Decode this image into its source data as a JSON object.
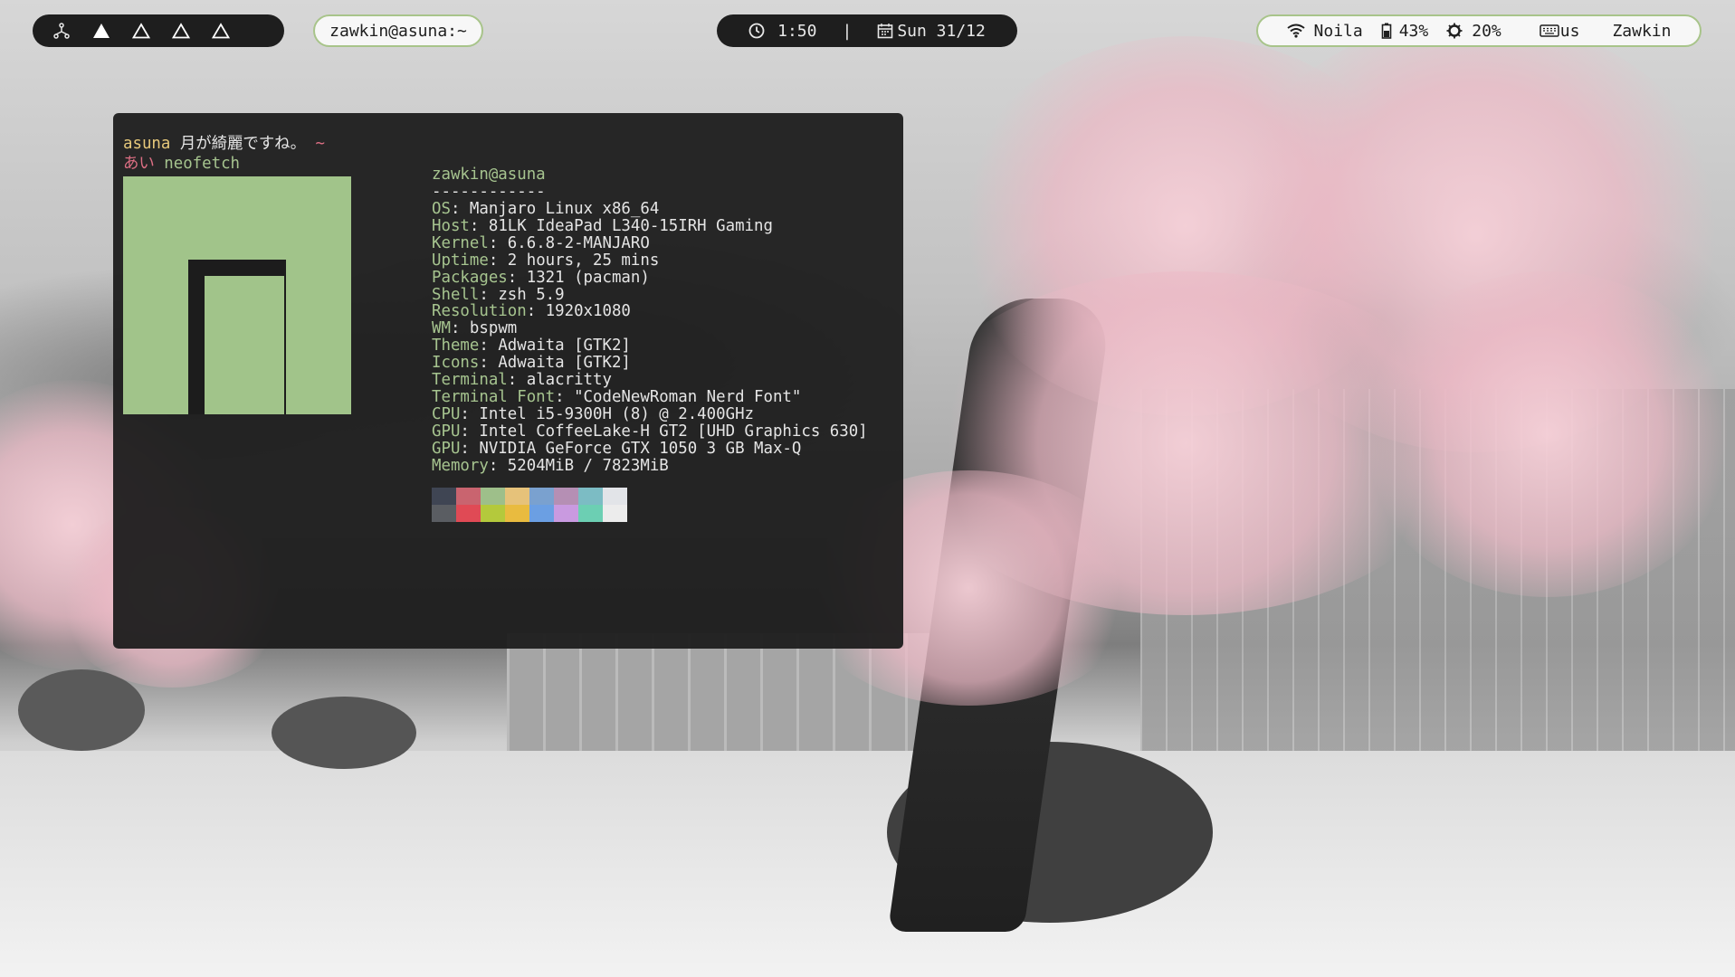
{
  "topbar": {
    "workspaces": [
      {
        "name": "workspace-1",
        "icon": "network-icon"
      },
      {
        "name": "workspace-2",
        "icon": "triangle-filled-icon"
      },
      {
        "name": "workspace-3",
        "icon": "triangle-outline-icon"
      },
      {
        "name": "workspace-4",
        "icon": "triangle-outline-icon"
      },
      {
        "name": "workspace-5",
        "icon": "triangle-outline-icon"
      }
    ],
    "window_title": "zawkin@asuna:~",
    "time": "1:50",
    "separator": "|",
    "date": "Sun 31/12",
    "wifi_name": "Noila",
    "battery": "43%",
    "brightness": "20%",
    "keyboard_layout": "us",
    "username": "Zawkin",
    "accent": "#a8c48a"
  },
  "terminal": {
    "prompt_user": "asuna",
    "prompt_text": " 月が綺麗ですね。",
    "prompt_dir": " ~",
    "prompt2_symbol": "あい",
    "command": " neofetch",
    "header": "zawkin@asuna",
    "divider": "------------",
    "info": [
      {
        "key": "OS",
        "value": " Manjaro Linux x86_64"
      },
      {
        "key": "Host",
        "value": " 81LK IdeaPad L340-15IRH Gaming"
      },
      {
        "key": "Kernel",
        "value": " 6.6.8-2-MANJARO"
      },
      {
        "key": "Uptime",
        "value": " 2 hours, 25 mins"
      },
      {
        "key": "Packages",
        "value": " 1321 (pacman)"
      },
      {
        "key": "Shell",
        "value": " zsh 5.9"
      },
      {
        "key": "Resolution",
        "value": " 1920x1080"
      },
      {
        "key": "WM",
        "value": " bspwm"
      },
      {
        "key": "Theme",
        "value": " Adwaita [GTK2]"
      },
      {
        "key": "Icons",
        "value": " Adwaita [GTK2]"
      },
      {
        "key": "Terminal",
        "value": " alacritty"
      },
      {
        "key": "Terminal Font",
        "value": " \"CodeNewRoman Nerd Font\""
      },
      {
        "key": "CPU",
        "value": " Intel i5-9300H (8) @ 2.400GHz"
      },
      {
        "key": "GPU",
        "value": " Intel CoffeeLake-H GT2 [UHD Graphics 630]"
      },
      {
        "key": "GPU",
        "value": " NVIDIA GeForce GTX 1050 3 GB Max-Q"
      },
      {
        "key": "Memory",
        "value": " 5204MiB / 7823MiB"
      }
    ],
    "palette_top": [
      "#3f4553",
      "#c9646f",
      "#9ebf8a",
      "#e6c27a",
      "#7aa1cf",
      "#b58fb4",
      "#7cbcc4",
      "#e2e4e8"
    ],
    "palette_bottom": [
      "#5a5d62",
      "#e04a55",
      "#b4c93c",
      "#e9bb3f",
      "#6b9fe3",
      "#c99ae0",
      "#6ccfb3",
      "#ececec"
    ],
    "logo_color": "#a1c48a"
  }
}
